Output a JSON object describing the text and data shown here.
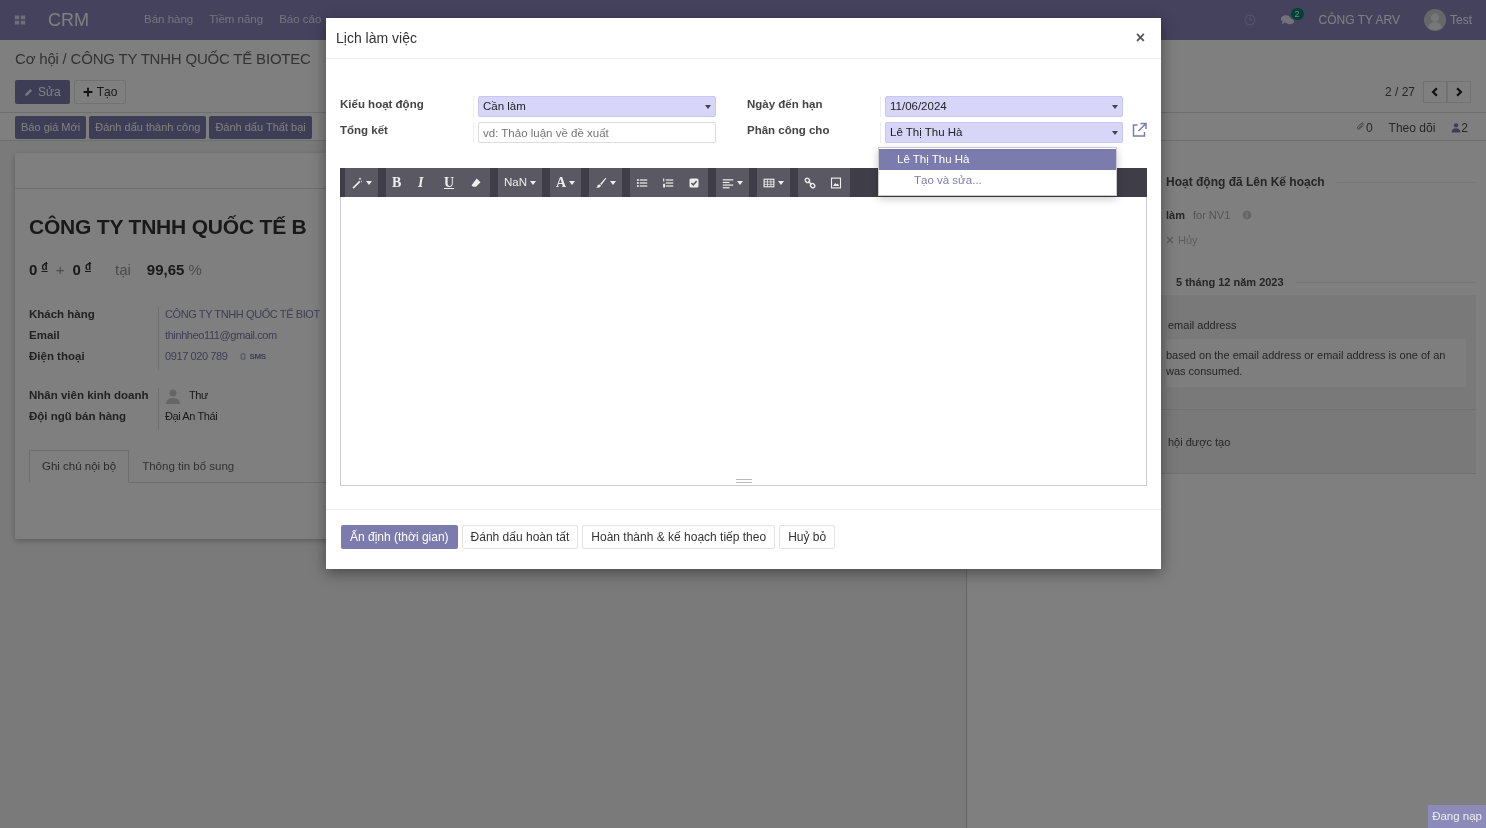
{
  "navbar": {
    "app": "CRM",
    "menu": [
      "Bán hàng",
      "Tiềm năng",
      "Báo cáo"
    ],
    "unread": "2",
    "company": "CÔNG TY ARV",
    "user": "Test"
  },
  "breadcrumb": "Cơ hội / CÔNG TY TNHH QUỐC TẾ BIOTEC",
  "actions": [
    {
      "label": "Sửa",
      "kind": "primary"
    },
    {
      "label": "Tạo",
      "kind": "secondary"
    }
  ],
  "pager": "2 / 27",
  "status_actions": [
    "Báo giá Mới",
    "Đánh dấu thành công",
    "Đánh dấu Thất bại"
  ],
  "chatter_bar": {
    "attachments": "0",
    "follow": "Theo dõi",
    "followers": "2"
  },
  "record": {
    "title": "CÔNG TY TNHH QUỐC TẾ B",
    "revenue": "0",
    "revenue_currency": "đ",
    "plus": "+",
    "recurring": "0",
    "recurring_currency": "đ",
    "at": "tại",
    "probability": "99,65",
    "percent": "%",
    "field_groups": [
      [
        {
          "label": "Khách hàng",
          "value": "CÔNG TY TNHH QUỐC TẾ BIOT",
          "kind": "link"
        },
        {
          "label": "Email",
          "value": "thinhheo111@gmail.com",
          "kind": "link"
        },
        {
          "label": "Điện thoại",
          "value": "0917 020 789",
          "sms": "SMS",
          "kind": "phone"
        }
      ],
      [
        {
          "label": "Nhân viên kinh doanh",
          "value": "Thư",
          "kind": "user"
        },
        {
          "label": "Đội ngũ bán hàng",
          "value": "Đại An Thái",
          "kind": "text"
        }
      ]
    ],
    "tabs": [
      {
        "label": "Ghi chú nội bộ",
        "selected": true
      },
      {
        "label": "Thông tin bổ sung",
        "selected": false
      }
    ]
  },
  "chatter": {
    "planned_title": "Hoạt động đã Lên Kế hoạch",
    "activity": {
      "type": "làm",
      "assignee": "for NV1",
      "cancel": "Hủy"
    },
    "date": "5 tháng 12 năm 2023",
    "messages": [
      {
        "subject": "email address",
        "body": [
          "based on the email address or email address is one of an",
          "was consumed."
        ]
      },
      {
        "subject": "hội được tạo"
      }
    ]
  },
  "dialog": {
    "title": "Lịch làm việc",
    "close": "×",
    "fields_left": [
      {
        "label": "Kiểu hoạt động",
        "kind": "select",
        "value": "Cần làm"
      },
      {
        "label": "Tổng kết",
        "kind": "input",
        "placeholder": "vd: Thảo luận về đề xuất"
      }
    ],
    "fields_right": [
      {
        "label": "Ngày đến hạn",
        "kind": "select",
        "value": "11/06/2024"
      },
      {
        "label": "Phân công cho",
        "kind": "many2one",
        "value": "Lê Thị Thu Hà"
      }
    ],
    "dropdown": [
      {
        "label": "Lê Thị Thu Hà",
        "kind": "option",
        "selected": true
      },
      {
        "label": "Tạo và sửa...",
        "kind": "create",
        "selected": false
      }
    ],
    "toolbar_labels": [
      "B",
      "I",
      "U",
      "NaN",
      "A"
    ],
    "buttons": [
      {
        "label": "Ấn định (thời gian)",
        "kind": "primary"
      },
      {
        "label": "Đánh dấu hoàn tất",
        "kind": "secondary"
      },
      {
        "label": "Hoàn thành & kế hoạch tiếp theo",
        "kind": "secondary"
      },
      {
        "label": "Huỷ bỏ",
        "kind": "secondary"
      }
    ]
  },
  "loading": "Đang nạp"
}
